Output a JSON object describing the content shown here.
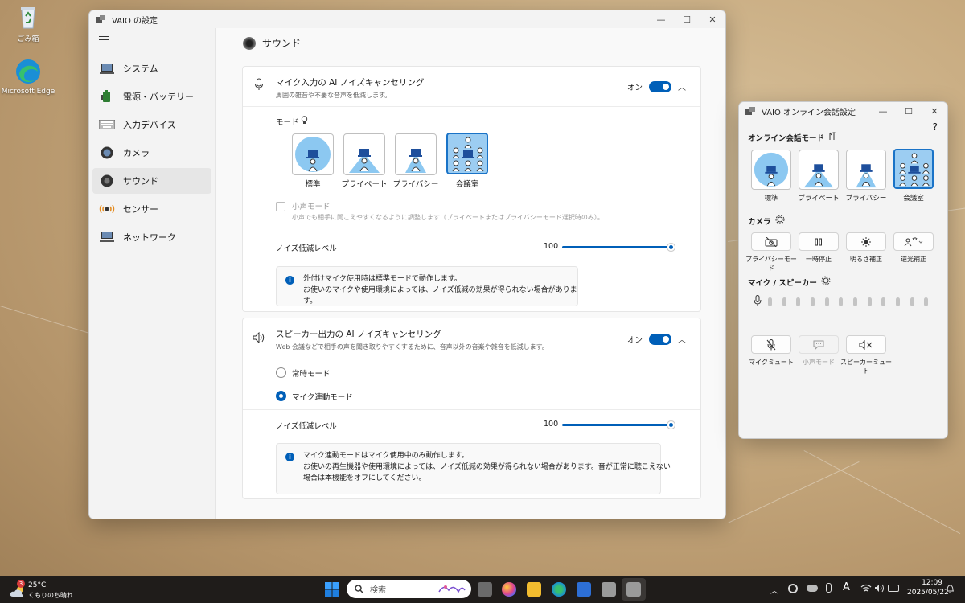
{
  "desktop": {
    "icons": [
      {
        "label": "ごみ箱",
        "icon": "recycle-bin-icon"
      },
      {
        "label": "Microsoft Edge",
        "icon": "edge-icon"
      }
    ]
  },
  "settings_window": {
    "title": "VAIO の設定",
    "controls": {
      "minimize": "—",
      "maximize": "☐",
      "close": "✕"
    },
    "nav": [
      {
        "label": "システム",
        "icon": "laptop-icon"
      },
      {
        "label": "電源・バッテリー",
        "icon": "battery-icon"
      },
      {
        "label": "入力デバイス",
        "icon": "keyboard-icon"
      },
      {
        "label": "カメラ",
        "icon": "camera-icon"
      },
      {
        "label": "サウンド",
        "icon": "speaker-icon",
        "selected": true
      },
      {
        "label": "センサー",
        "icon": "sensor-icon"
      },
      {
        "label": "ネットワーク",
        "icon": "network-icon"
      }
    ],
    "page_title": "サウンド",
    "mic_card": {
      "title": "マイク入力の AI ノイズキャンセリング",
      "subtitle": "周囲の雑音や不要な音声を低減します。",
      "toggle_label": "オン",
      "mode_label": "モード",
      "modes": [
        {
          "label": "標準"
        },
        {
          "label": "プライベート"
        },
        {
          "label": "プライバシー"
        },
        {
          "label": "会議室",
          "selected": true
        }
      ],
      "small_voice_label": "小声モード",
      "small_voice_desc": "小声でも相手に聞こえやすくなるように調整します（プライベートまたはプライバシーモード選択時のみ）。",
      "noise_label": "ノイズ低減レベル",
      "noise_value": "100",
      "noise_fraction": 1.0,
      "info_line1": "外付けマイク使用時は標準モードで動作します。",
      "info_line2": "お使いのマイクや使用環境によっては、ノイズ低減の効果が得られない場合があります。"
    },
    "speaker_card": {
      "title": "スピーカー出力の AI ノイズキャンセリング",
      "subtitle": "Web 会議などで相手の声を聞き取りやすくするために、音声以外の音楽や雑音を低減します。",
      "toggle_label": "オン",
      "option_always": "常時モード",
      "option_mic_linked": "マイク連動モード",
      "noise_label": "ノイズ低減レベル",
      "noise_value": "100",
      "noise_fraction": 1.0,
      "info_line1": "マイク連動モードはマイク使用中のみ動作します。",
      "info_line2": "お使いの再生機器や使用環境によっては、ノイズ低減の効果が得られない場合があります。音が正常に聴こえない",
      "info_line3": "場合は本機能をオフにしてください。"
    }
  },
  "online_window": {
    "title": "VAIO オンライン会話設定",
    "help": "?",
    "mode_section": "オンライン会話モード",
    "modes": [
      {
        "label": "標準"
      },
      {
        "label": "プライベート"
      },
      {
        "label": "プライバシー"
      },
      {
        "label": "会議室",
        "selected": true
      }
    ],
    "camera_section": "カメラ",
    "camera_buttons": [
      {
        "label": "プライバシーモード",
        "icon": "camera-off-icon"
      },
      {
        "label": "一時停止",
        "icon": "pause-icon"
      },
      {
        "label": "明るさ補正",
        "icon": "brightness-icon"
      },
      {
        "label": "逆光補正",
        "icon": "backlight-icon"
      }
    ],
    "mic_section": "マイク / スピーカー",
    "mic_level_bars": 12,
    "audio_buttons": [
      {
        "label": "マイクミュート",
        "icon": "mic-mute-icon",
        "enabled": true
      },
      {
        "label": "小声モード",
        "icon": "chat-icon",
        "enabled": false
      },
      {
        "label": "スピーカーミュート",
        "icon": "speaker-mute-icon",
        "enabled": true
      }
    ]
  },
  "taskbar": {
    "weather_temp": "25°C",
    "weather_desc": "くもりのち晴れ",
    "weather_badge": "3",
    "search_placeholder": "検索",
    "time": "12:09",
    "date": "2025/05/22",
    "ime": "A"
  }
}
